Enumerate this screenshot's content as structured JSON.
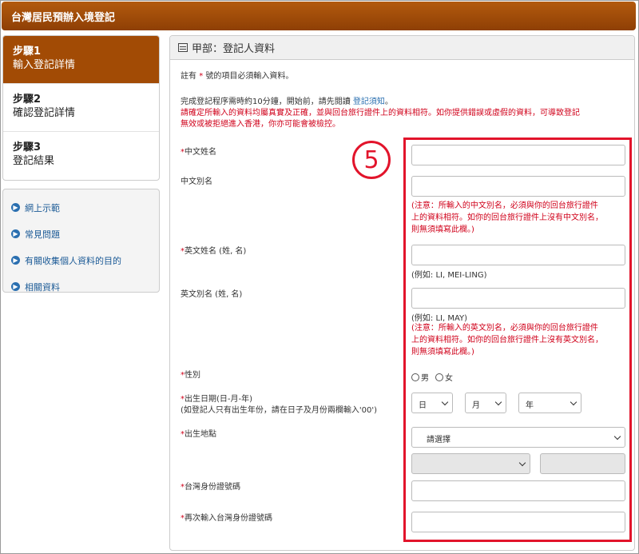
{
  "header": {
    "title": "台灣居民預辦入境登記"
  },
  "steps": [
    {
      "num": "步驟1",
      "label": "輸入登記詳情",
      "active": true
    },
    {
      "num": "步驟2",
      "label": "確認登記詳情",
      "active": false
    },
    {
      "num": "步驟3",
      "label": "登記結果",
      "active": false
    }
  ],
  "links": [
    "網上示範",
    "常見問題",
    "有關收集個人資料的目的",
    "相關資料"
  ],
  "panel": {
    "title": "甲部：登記人資料",
    "required_note_pre": "註有 ",
    "required_star": "*",
    "required_note_post": " 號的項目必須輸入資料。",
    "intro_pre": "完成登記程序需時約10分鐘，開始前，請先閱讀 ",
    "intro_link": "登記須知",
    "intro_post": "。",
    "warning_line1": "請確定所輸入的資料均屬真實及正確，並與回台旅行證件上的資料相符。如你提供錯誤或虛假的資料，可導致登記",
    "warning_line2": "無效或被拒絕進入香港，你亦可能會被檢控。"
  },
  "form": {
    "chinese_name": "中文姓名",
    "chinese_alias": "中文別名",
    "chinese_alias_note": [
      "(注意：所輸入的中文別名，必須與你的回台旅行證件",
      "上的資料相符。如你的回台旅行證件上沒有中文別名，",
      "則無須填寫此欄。)"
    ],
    "english_name": "英文姓名 (姓, 名)",
    "english_name_example": "(例如: LI, MEI-LING)",
    "english_alias": "英文別名 (姓, 名)",
    "english_alias_example": "(例如: LI, MAY)",
    "english_alias_note": [
      "(注意：所輸入的英文別名，必須與你的回台旅行證件",
      "上的資料相符。如你的回台旅行證件上沒有英文別名，",
      "則無須填寫此欄。)"
    ],
    "gender": "性別",
    "gender_male": "男",
    "gender_female": "女",
    "dob": "出生日期(日-月-年)",
    "dob_note": "(如登記人只有出生年份，請在日子及月份兩欄輸入'00')",
    "dob_day": "日",
    "dob_month": "月",
    "dob_year": "年",
    "birthplace": "出生地點",
    "birthplace_select": "請選擇",
    "taiwan_id": "台灣身份證號碼",
    "taiwan_id_confirm": "再次輸入台灣身份證號碼",
    "star": "*"
  },
  "annotation": {
    "number": "5"
  }
}
